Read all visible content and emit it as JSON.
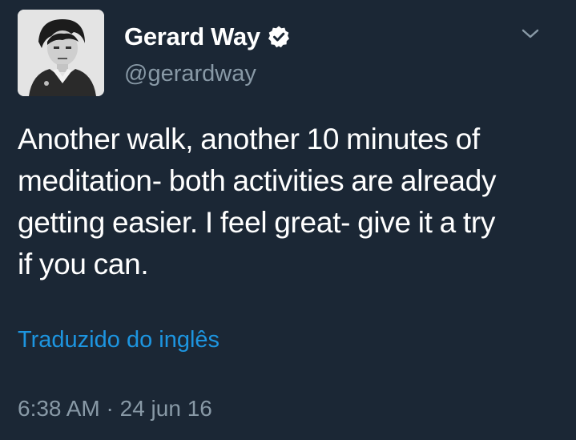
{
  "user": {
    "display_name": "Gerard Way",
    "handle": "@gerardway",
    "verified": true,
    "verified_icon": "verified-badge-icon"
  },
  "tweet": {
    "text_lines": [
      "Another walk, another 10 minutes of",
      "meditation- both activities are already",
      "getting easier. I feel great- give it a try",
      "if you can."
    ],
    "translate_label": "Traduzido do inglês",
    "time": "6:38 AM",
    "separator": "·",
    "date": "24 jun 16"
  },
  "menu": {
    "icon": "chevron-down-icon"
  },
  "colors": {
    "background": "#1b2735",
    "primary_text": "#ffffff",
    "secondary_text": "#8899a6",
    "link": "#1d95e0"
  }
}
